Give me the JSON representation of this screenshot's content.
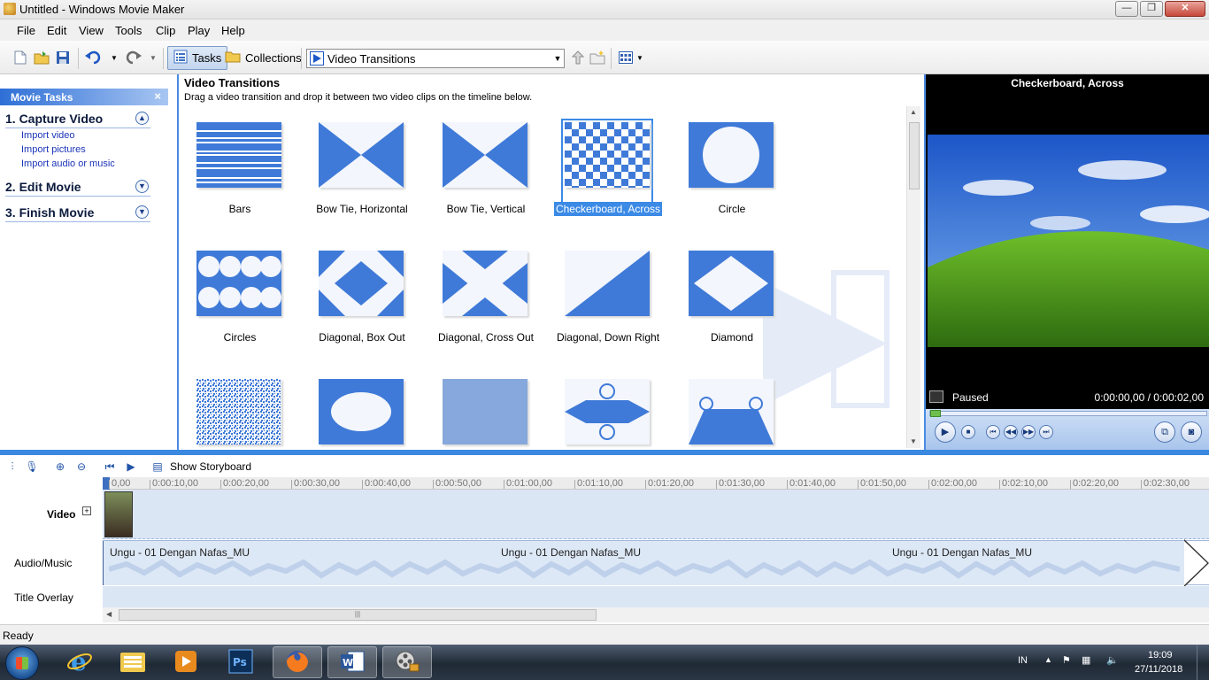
{
  "window": {
    "title": "Untitled - Windows Movie Maker",
    "minimize": "—",
    "maximize": "❐",
    "close": "✕"
  },
  "menu": [
    "File",
    "Edit",
    "View",
    "Tools",
    "Clip",
    "Play",
    "Help"
  ],
  "toolbar": {
    "tasks_label": "Tasks",
    "collections_label": "Collections",
    "collection_combo_value": "Video Transitions"
  },
  "tasks_pane": {
    "header": "Movie Tasks",
    "close": "×",
    "sections": [
      {
        "title": "1. Capture Video",
        "expanded": true,
        "links": [
          "Import video",
          "Import pictures",
          "Import audio or music"
        ]
      },
      {
        "title": "2. Edit Movie",
        "expanded": false,
        "links": []
      },
      {
        "title": "3. Finish Movie",
        "expanded": false,
        "links": []
      }
    ]
  },
  "content": {
    "title": "Video Transitions",
    "subtitle": "Drag a video transition and drop it between two video clips on the timeline below.",
    "transitions": [
      {
        "name": "Bars",
        "selected": false
      },
      {
        "name": "Bow Tie, Horizontal",
        "selected": false
      },
      {
        "name": "Bow Tie, Vertical",
        "selected": false
      },
      {
        "name": "Checkerboard, Across",
        "selected": true
      },
      {
        "name": "Circle",
        "selected": false
      },
      {
        "name": "Circles",
        "selected": false
      },
      {
        "name": "Diagonal, Box Out",
        "selected": false
      },
      {
        "name": "Diagonal, Cross Out",
        "selected": false
      },
      {
        "name": "Diagonal, Down Right",
        "selected": false
      },
      {
        "name": "Diamond",
        "selected": false
      }
    ]
  },
  "monitor": {
    "title": "Checkerboard, Across",
    "status": "Paused",
    "time": "0:00:00,00 / 0:00:02,00",
    "progress": 0
  },
  "timeline": {
    "show_storyboard": "Show Storyboard",
    "tracks": {
      "video": "Video",
      "audio": "Audio/Music",
      "title": "Title Overlay"
    },
    "ruler": [
      "0,00",
      "0:00:10,00",
      "0:00:20,00",
      "0:00:30,00",
      "0:00:40,00",
      "0:00:50,00",
      "0:01:00,00",
      "0:01:10,00",
      "0:01:20,00",
      "0:01:30,00",
      "0:01:40,00",
      "0:01:50,00",
      "0:02:00,00",
      "0:02:10,00",
      "0:02:20,00",
      "0:02:30,00"
    ],
    "audio_clips": [
      "Ungu - 01 Dengan Nafas_MU",
      "Ungu - 01 Dengan Nafas_MU",
      "Ungu - 01 Dengan Nafas_MU"
    ]
  },
  "statusbar": {
    "text": "Ready"
  },
  "taskbar": {
    "apps": [
      "internet-explorer",
      "file-explorer",
      "media-player",
      "photoshop",
      "firefox",
      "word",
      "movie-maker"
    ],
    "language": "IN",
    "time": "19:09",
    "date": "27/11/2018"
  },
  "colors": {
    "accent": "#3b8ae6",
    "transition_blue": "#3f7ad8"
  }
}
